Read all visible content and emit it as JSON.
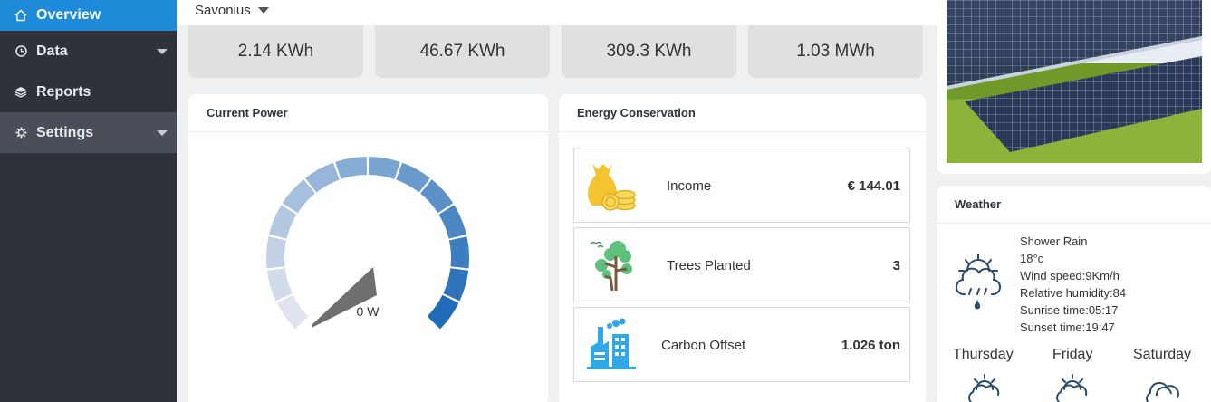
{
  "sidebar": {
    "items": [
      {
        "label": "Overview",
        "icon": "home-icon"
      },
      {
        "label": "Data",
        "icon": "clock-icon"
      },
      {
        "label": "Reports",
        "icon": "layers-icon"
      },
      {
        "label": "Settings",
        "icon": "gear-icon"
      }
    ]
  },
  "header": {
    "site": "Savonius"
  },
  "stats": [
    "2.14 KWh",
    "46.67 KWh",
    "309.3 KWh",
    "1.03 MWh"
  ],
  "current_power": {
    "title": "Current Power",
    "value_label": "0 W",
    "fraction": 0
  },
  "energy_conservation": {
    "title": "Energy Conservation",
    "rows": [
      {
        "label": "Income",
        "value": "€ 144.01",
        "icon": "money-bag-icon"
      },
      {
        "label": "Trees Planted",
        "value": "3",
        "icon": "tree-icon"
      },
      {
        "label": "Carbon Offset",
        "value": "1.026 ton",
        "icon": "factory-icon"
      }
    ]
  },
  "weather": {
    "title": "Weather",
    "condition": "Shower Rain",
    "temp": "18°c",
    "wind": "Wind speed:9Km/h",
    "humidity": "Relative humidity:84",
    "sunrise": "Sunrise time:05:17",
    "sunset": "Sunset time:19:47",
    "days": [
      "Thursday",
      "Friday",
      "Saturday"
    ]
  },
  "colors": {
    "accent": "#1f8bd8",
    "sidebar": "#2f323a",
    "gauge_dark": "#1f6bb8",
    "gauge_light": "#e1e4ee"
  }
}
